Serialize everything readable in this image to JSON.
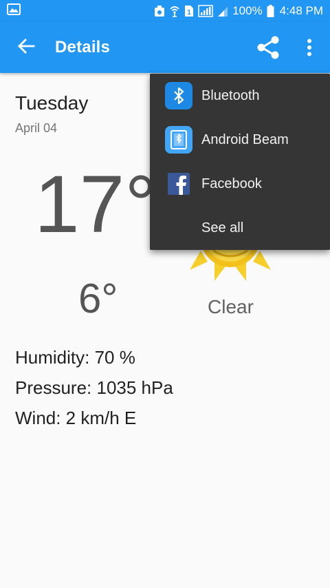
{
  "status_bar": {
    "battery": "100%",
    "time": "4:48 PM"
  },
  "toolbar": {
    "title": "Details"
  },
  "forecast": {
    "day": "Tuesday",
    "date": "April 04",
    "high": "17°",
    "low": "6°",
    "condition": "Clear",
    "humidity": "Humidity: 70 %",
    "pressure": "Pressure: 1035 hPa",
    "wind": "Wind: 2 km/h E"
  },
  "share_menu": {
    "items": [
      {
        "label": "Bluetooth",
        "icon": "bluetooth-icon"
      },
      {
        "label": "Android Beam",
        "icon": "android-beam-icon"
      },
      {
        "label": "Facebook",
        "icon": "facebook-icon"
      },
      {
        "label": "See all",
        "icon": ""
      }
    ]
  },
  "colors": {
    "primary": "#2196f3",
    "menu_bg": "#353535",
    "sun": "#f6cf2a",
    "bluetooth": "#1e88e5",
    "facebook": "#3b5998"
  }
}
